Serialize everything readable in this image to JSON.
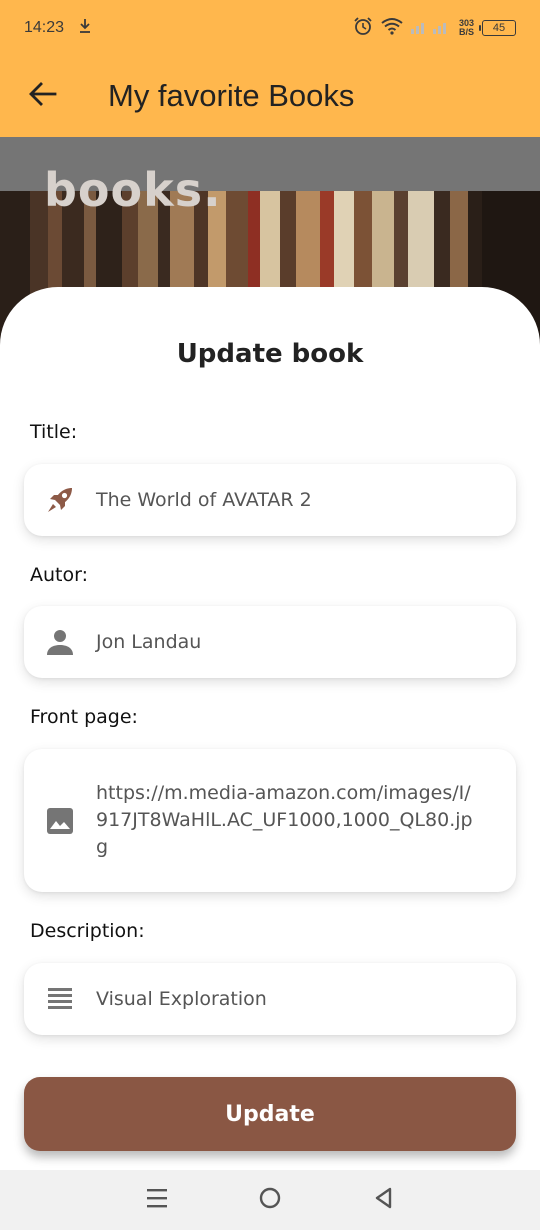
{
  "status_bar": {
    "time": "14:23",
    "speed_value": "303",
    "speed_unit": "B/S",
    "battery": "45",
    "icons": [
      "download-icon",
      "alarm-icon",
      "wifi-icon",
      "signal-icon",
      "battery-icon"
    ]
  },
  "app_bar": {
    "title": "My favorite Books",
    "back_icon": "arrow-left-icon"
  },
  "hero": {
    "text": "books."
  },
  "form": {
    "heading": "Update book",
    "title_label": "Title:",
    "title_value": "The World of AVATAR 2",
    "title_icon": "rocket-icon",
    "author_label": "Autor:",
    "author_value": "Jon Landau",
    "author_icon": "person-icon",
    "front_label": "Front page:",
    "front_value": "https://m.media-amazon.com/images/I/917JT8WaHlL.AC_UF1000,1000_QL80.jpg",
    "front_icon": "image-icon",
    "desc_label": "Description:",
    "desc_value": "Visual Exploration",
    "desc_icon": "notes-icon",
    "update_label": "Update"
  },
  "nav_bar": {
    "items": [
      "recent-apps-icon",
      "home-icon",
      "back-icon"
    ]
  },
  "colors": {
    "app_bar": "#ffb74d",
    "button": "#8a5744",
    "title_icon": "#8d5a47"
  }
}
